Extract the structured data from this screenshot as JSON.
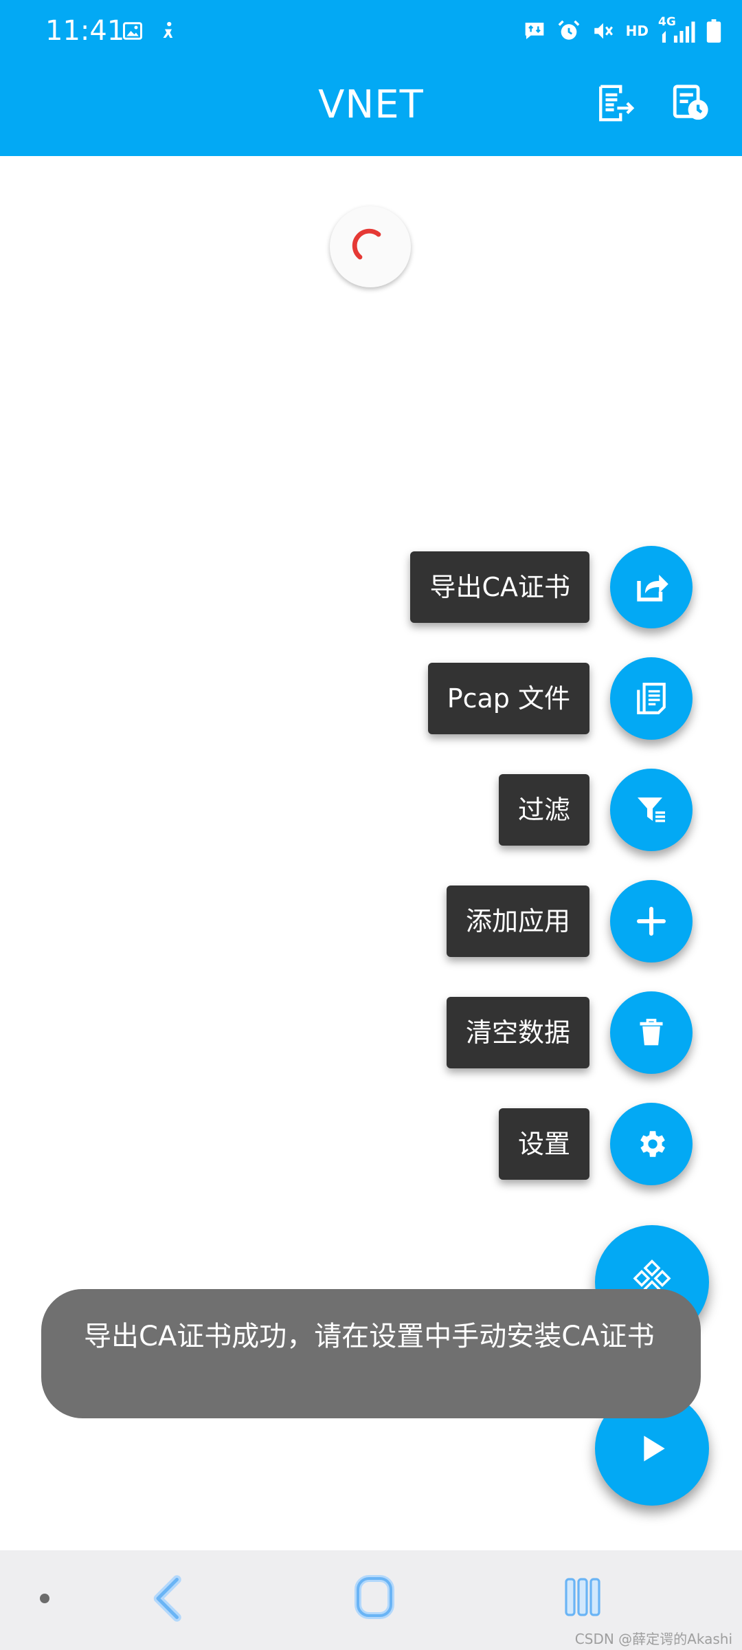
{
  "status_bar": {
    "time": "11:41",
    "hd": "HD",
    "net": "4G"
  },
  "app_bar": {
    "title": "VNET"
  },
  "fab_menu": {
    "items": [
      {
        "label": "导出CA证书",
        "icon": "share-icon"
      },
      {
        "label": "Pcap 文件",
        "icon": "document-icon"
      },
      {
        "label": "过滤",
        "icon": "filter-icon"
      },
      {
        "label": "添加应用",
        "icon": "plus-icon"
      },
      {
        "label": "清空数据",
        "icon": "trash-icon"
      },
      {
        "label": "设置",
        "icon": "gear-icon"
      }
    ]
  },
  "toast": {
    "message": "导出CA证书成功，请在设置中手动安装CA证书"
  },
  "watermark": "CSDN @薛定谔的Akashi",
  "colors": {
    "primary": "#03a9f4",
    "label_bg": "#333333",
    "toast_bg": "#707070",
    "spinner": "#e53935"
  }
}
